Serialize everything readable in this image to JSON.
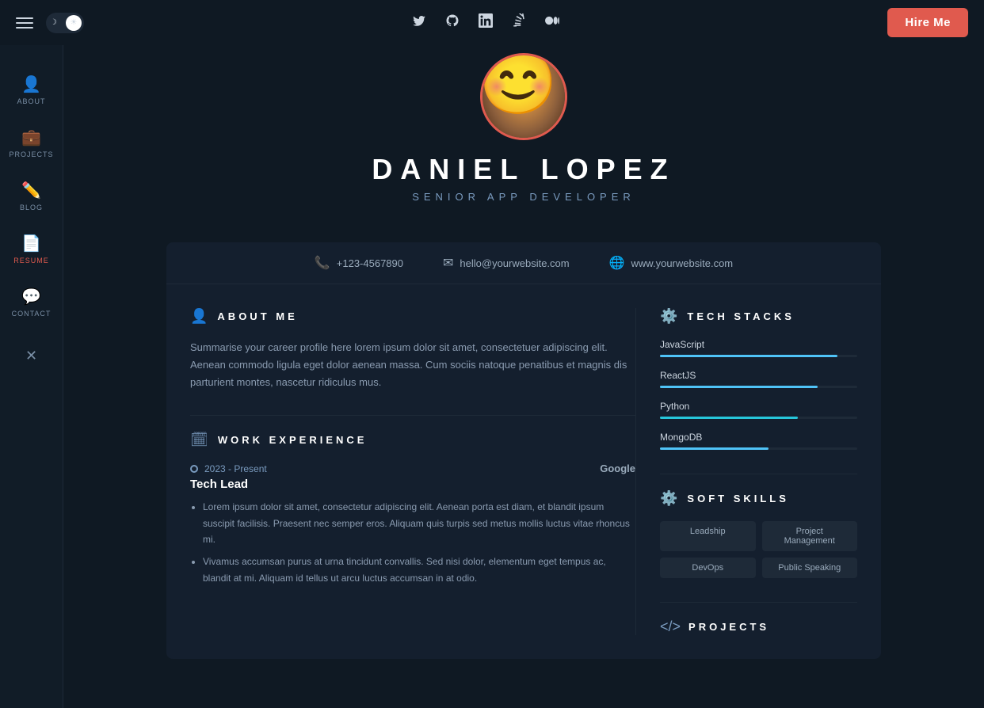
{
  "topnav": {
    "hire_label": "Hire Me",
    "socials": [
      {
        "name": "twitter",
        "icon": "𝕏",
        "label": "Twitter"
      },
      {
        "name": "github",
        "icon": "⌥",
        "label": "GitHub"
      },
      {
        "name": "linkedin",
        "icon": "in",
        "label": "LinkedIn"
      },
      {
        "name": "stackoverflow",
        "icon": "⧉",
        "label": "StackOverflow"
      },
      {
        "name": "medium",
        "icon": "◎",
        "label": "Medium"
      }
    ]
  },
  "sidebar": {
    "items": [
      {
        "label": "About",
        "icon": "👤",
        "id": "about"
      },
      {
        "label": "Projects",
        "icon": "💼",
        "id": "projects"
      },
      {
        "label": "Blog",
        "icon": "✏️",
        "id": "blog"
      },
      {
        "label": "Resume",
        "icon": "📄",
        "id": "resume"
      },
      {
        "label": "Contact",
        "icon": "💬",
        "id": "contact"
      }
    ],
    "active": "resume"
  },
  "hero": {
    "name": "Daniel Lopez",
    "title": "Senior App Developer",
    "phone": "+123-4567890",
    "email": "hello@yourwebsite.com",
    "website": "www.yourwebsite.com"
  },
  "about": {
    "section_title": "About Me",
    "text": "Summarise your career profile here lorem ipsum dolor sit amet, consectetuer adipiscing elit. Aenean commodo ligula eget dolor aenean massa. Cum sociis natoque penatibus et magnis dis parturient montes, nascetur ridiculus mus."
  },
  "work_experience": {
    "section_title": "Work Experience",
    "jobs": [
      {
        "dates": "2023 - Present",
        "company": "Google",
        "role": "Tech Lead",
        "bullets": [
          "Lorem ipsum dolor sit amet, consectetur adipiscing elit. Aenean porta est diam, et blandit ipsum suscipit facilisis. Praesent nec semper eros. Aliquam quis turpis sed metus mollis luctus vitae rhoncus mi.",
          "Vivamus accumsan purus at urna tincidunt convallis. Sed nisi dolor, elementum eget tempus ac, blandit at mi. Aliquam id tellus ut arcu luctus accumsan in at odio."
        ]
      }
    ]
  },
  "tech_stacks": {
    "section_title": "Tech Stacks",
    "items": [
      {
        "name": "JavaScript",
        "percent": 90,
        "color": "#4fc3f7"
      },
      {
        "name": "ReactJS",
        "percent": 80,
        "color": "#4fc3f7"
      },
      {
        "name": "Python",
        "percent": 70,
        "color": "#26c6da"
      },
      {
        "name": "MongoDB",
        "percent": 55,
        "color": "#4fc3f7"
      }
    ]
  },
  "soft_skills": {
    "section_title": "Soft Skills",
    "items": [
      "Leadship",
      "Project Management",
      "DevOps",
      "Public Speaking"
    ]
  },
  "projects": {
    "section_title": "Projects"
  }
}
